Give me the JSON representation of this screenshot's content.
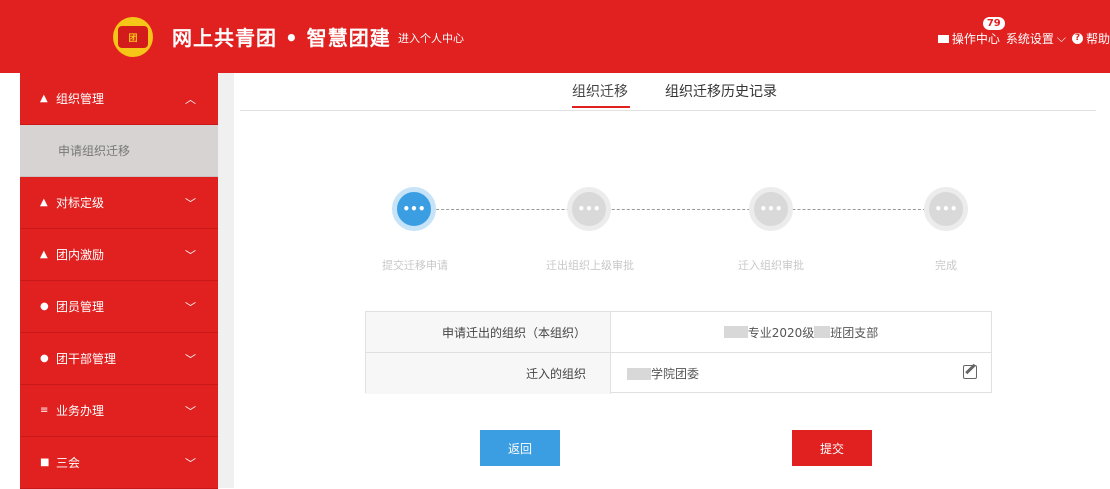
{
  "header": {
    "title": "网上共青团 • 智慧团建",
    "personal_center": "进入个人中心",
    "ops_center": "操作中心",
    "ops_badge": "79",
    "settings": "系统设置",
    "help": "帮助",
    "color": "#e12020"
  },
  "sidebar": {
    "items": [
      {
        "label": "组织管理",
        "chevron": "^"
      },
      {
        "label": "申请组织迁移"
      },
      {
        "label": "对标定级",
        "chevron": "v"
      },
      {
        "label": "团内激励",
        "chevron": "v"
      },
      {
        "label": "团员管理",
        "chevron": "v"
      },
      {
        "label": "团干部管理",
        "chevron": "v"
      },
      {
        "label": "业务办理",
        "chevron": "v"
      },
      {
        "label": "三会",
        "chevron": "v"
      }
    ]
  },
  "tabs": [
    {
      "label": "组织迁移"
    },
    {
      "label": "组织迁移历史记录"
    }
  ],
  "steps": [
    {
      "label": "提交迁移申请",
      "dots": "•••"
    },
    {
      "label": "迁出组织上级审批",
      "dots": "•••"
    },
    {
      "label": "迁入组织审批",
      "dots": "•••"
    },
    {
      "label": "完成",
      "dots": "•••"
    }
  ],
  "form": {
    "out_label": "申请迁出的组织（本组织）",
    "out_value_a": "专业2020级",
    "out_value_b": "班团支部",
    "in_label": "迁入的组织",
    "in_value": "学院团委"
  },
  "buttons": {
    "back": "返回",
    "submit": "提交"
  }
}
